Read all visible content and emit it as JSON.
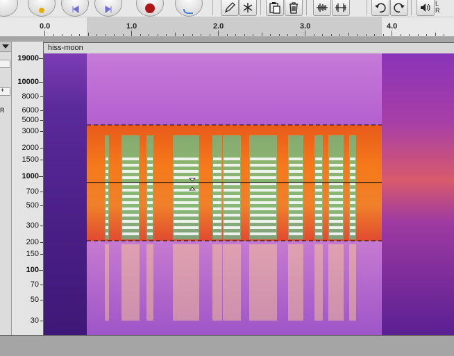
{
  "toolbar": {
    "tools": [
      {
        "name": "draw-tool",
        "icon": "pencil-icon"
      },
      {
        "name": "multi-tool",
        "icon": "asterisk-icon"
      },
      {
        "name": "paste-button",
        "icon": "clipboard-icon"
      },
      {
        "name": "delete-button",
        "icon": "trash-icon"
      },
      {
        "name": "trim-button",
        "icon": "trim-audio-icon"
      },
      {
        "name": "silence-button",
        "icon": "silence-audio-icon"
      },
      {
        "name": "undo-button",
        "icon": "undo-icon"
      },
      {
        "name": "redo-button",
        "icon": "redo-icon"
      },
      {
        "name": "volume-button",
        "icon": "speaker-icon"
      }
    ],
    "meter_left": "L",
    "meter_right": "R"
  },
  "ruler": {
    "labels": [
      "0.0",
      "1.0",
      "2.0",
      "3.0",
      "4.0"
    ],
    "selection_start_sec": 0.48,
    "selection_end_sec": 3.88
  },
  "track": {
    "name": "hiss-moon",
    "pan_plus": "+",
    "pan_right": "R",
    "frequency_labels": [
      "19000",
      "10000",
      "8000",
      "6000",
      "5000",
      "3000",
      "2000",
      "1500",
      "1000",
      "700",
      "500",
      "300",
      "200",
      "150",
      "100",
      "70",
      "50",
      "30"
    ],
    "selection_low_hz": 200,
    "selection_center_hz": 900,
    "selection_high_hz": 3600
  }
}
